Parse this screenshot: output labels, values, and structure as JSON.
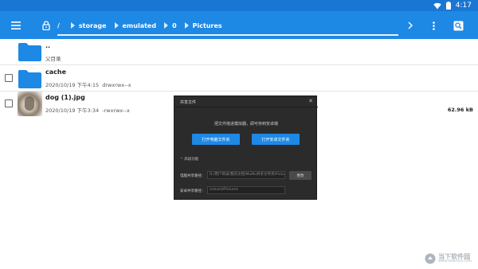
{
  "status_bar": {
    "time": "4:17",
    "icons": [
      "wifi-icon",
      "battery-icon"
    ]
  },
  "app_bar": {
    "icons": [
      "menu-icon",
      "lock-icon",
      "chevron-right-icon",
      "more-vert-icon",
      "search-icon"
    ],
    "path_root": "/",
    "breadcrumbs": [
      "storage",
      "emulated",
      "0",
      "Pictures"
    ]
  },
  "files": [
    {
      "name": "..",
      "meta": "父目录",
      "type": "parent-folder"
    },
    {
      "name": "cache",
      "meta": "2020/10/19 下午4:15  drwxrwx--x",
      "type": "folder"
    },
    {
      "name": "dog (1).jpg",
      "meta": "2020/10/19 下午3:34  -rwxrwx--x",
      "size": "62.96 kB",
      "type": "image"
    }
  ],
  "dialog": {
    "title": "共享文件",
    "description": "把文件拖进模拟器，即可存到安卓端",
    "btn_open_pc": "打开电脑文件夹",
    "btn_open_android": "打开安卓文件夹",
    "advanced_label": "高级功能",
    "pc_path_label": "电脑共享路径：",
    "pc_path_value": "D:/用户目录/我的文档/MuMu共享文件夹/Pictures",
    "change_btn": "更改",
    "android_path_label": "安卓共享路径：",
    "android_path_value": "/sdcard/Pictures"
  },
  "watermark": {
    "main": "当下软件园",
    "sub": "www.downxia.com"
  },
  "colors": {
    "app_bar": "#1e88e5",
    "status_bar": "#1976d2",
    "folder": "#1e88e5",
    "dialog_bg": "#2b2b2b",
    "button": "#1e88e5"
  }
}
